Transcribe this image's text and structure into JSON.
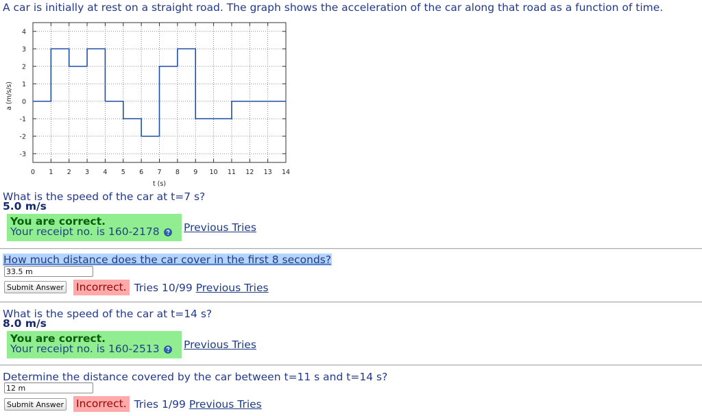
{
  "intro": "A car is initially at rest on a straight road. The graph shows the acceleration of the car along that road as a function of time.",
  "chart_data": {
    "type": "line",
    "step": true,
    "xlabel": "t (s)",
    "ylabel": "a (m/s/s)",
    "xlim": [
      0,
      14
    ],
    "ylim": [
      -3.5,
      4.5
    ],
    "xticks": [
      0,
      1,
      2,
      3,
      4,
      5,
      6,
      7,
      8,
      9,
      10,
      11,
      12,
      13,
      14
    ],
    "yticks": [
      4,
      3,
      2,
      1,
      0,
      -1,
      -2,
      -3
    ],
    "grid": true,
    "series": [
      {
        "color": "#1f4ea6",
        "segments": [
          {
            "t": [
              0,
              1
            ],
            "a": 0
          },
          {
            "t": [
              1,
              2
            ],
            "a": 3
          },
          {
            "t": [
              2,
              3
            ],
            "a": 2
          },
          {
            "t": [
              3,
              4
            ],
            "a": 3
          },
          {
            "t": [
              4,
              5
            ],
            "a": 0
          },
          {
            "t": [
              5,
              6
            ],
            "a": -1
          },
          {
            "t": [
              6,
              7
            ],
            "a": -2
          },
          {
            "t": [
              7,
              8
            ],
            "a": 2
          },
          {
            "t": [
              8,
              9
            ],
            "a": 3
          },
          {
            "t": [
              9,
              11
            ],
            "a": -1
          },
          {
            "t": [
              11,
              14
            ],
            "a": 0
          }
        ]
      }
    ]
  },
  "problems": [
    {
      "question": "What is the speed of the car at t=7 s?",
      "answer": "5.0 m/s",
      "result": "You are correct.",
      "receipt": "Your receipt no. is 160-2178",
      "previous_tries": "Previous Tries"
    },
    {
      "question": "How much distance does the car cover in the first 8 seconds?",
      "input_value": "33.5 m",
      "submit_label": "Submit Answer",
      "result": "Incorrect.",
      "tries": "Tries 10/99",
      "previous_tries": "Previous Tries"
    },
    {
      "question": "What is the speed of the car at t=14 s?",
      "answer": "8.0 m/s",
      "result": "You are correct.",
      "receipt": "Your receipt no. is 160-2513",
      "previous_tries": "Previous Tries"
    },
    {
      "question": "Determine the distance covered by the car between t=11 s and t=14 s?",
      "input_value": "12 m",
      "submit_label": "Submit Answer",
      "result": "Incorrect.",
      "tries": "Tries 1/99",
      "previous_tries": "Previous Tries"
    }
  ],
  "icons": {
    "help": "help-icon"
  },
  "colors": {
    "text": "#22398a",
    "answer": "#14286a",
    "correct_bg": "#90ee90",
    "correct_text": "#0a5d0a",
    "receipt": "#1e4285",
    "incorrect_bg": "#ffaaaa",
    "incorrect_text": "#a10000",
    "highlight": "#b3d4fc",
    "link": "#1c3c86"
  }
}
